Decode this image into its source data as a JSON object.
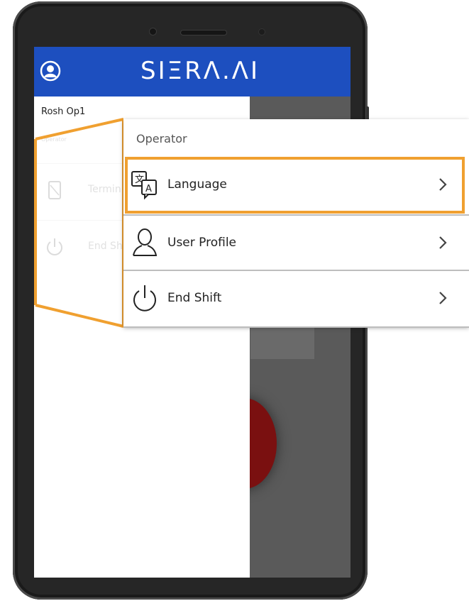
{
  "app": {
    "brand": "SIΞRΛ.ΛI",
    "appbar_color": "#1d4fbf"
  },
  "drawer": {
    "user_name": "Rosh Op1",
    "role": "Operator",
    "items": [
      {
        "label": "Termin",
        "icon": "terminal-device-icon"
      },
      {
        "label": "End Sh",
        "icon": "power-icon"
      }
    ]
  },
  "zoom_panel": {
    "header": "Operator",
    "items": [
      {
        "label": "Language",
        "icon": "translate-icon",
        "highlighted": true
      },
      {
        "label": "User Profile",
        "icon": "user-icon",
        "highlighted": false
      },
      {
        "label": "End Shift",
        "icon": "power-icon",
        "highlighted": false
      }
    ],
    "highlight_color": "#f0a030"
  }
}
